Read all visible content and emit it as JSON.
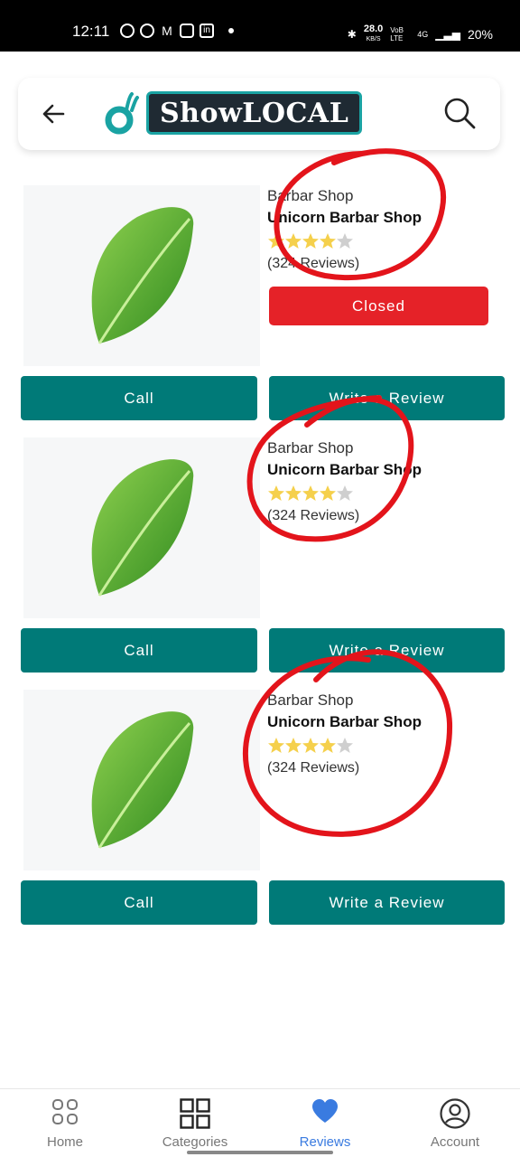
{
  "status_bar": {
    "time": "12:11",
    "net_speed": "28.0",
    "net_unit": "KB/S",
    "volte": "VoB LTE",
    "network": "4G",
    "battery": "20%"
  },
  "header": {
    "logo_text": "ShowLOCAL"
  },
  "listings": [
    {
      "category": "Barbar Shop",
      "name": "Unicorn Barbar Shop",
      "rating": 4,
      "reviews": "(324 Reviews)",
      "status": "Closed",
      "call_label": "Call",
      "review_label": "Write a Review"
    },
    {
      "category": "Barbar Shop",
      "name": "Unicorn Barbar Shop",
      "rating": 4,
      "reviews": "(324 Reviews)",
      "call_label": "Call",
      "review_label": "Write a Review"
    },
    {
      "category": "Barbar Shop",
      "name": "Unicorn Barbar Shop",
      "rating": 4,
      "reviews": "(324 Reviews)",
      "call_label": "Call",
      "review_label": "Write a Review"
    }
  ],
  "bottom_nav": [
    {
      "label": "Home",
      "icon": "home-grid-icon"
    },
    {
      "label": "Categories",
      "icon": "categories-icon"
    },
    {
      "label": "Reviews",
      "icon": "heart-icon",
      "active": true
    },
    {
      "label": "Account",
      "icon": "account-icon"
    }
  ],
  "colors": {
    "teal": "#007a78",
    "closed_red": "#e52228",
    "active_blue": "#3a7be0",
    "annotation_red": "#e3141b"
  }
}
